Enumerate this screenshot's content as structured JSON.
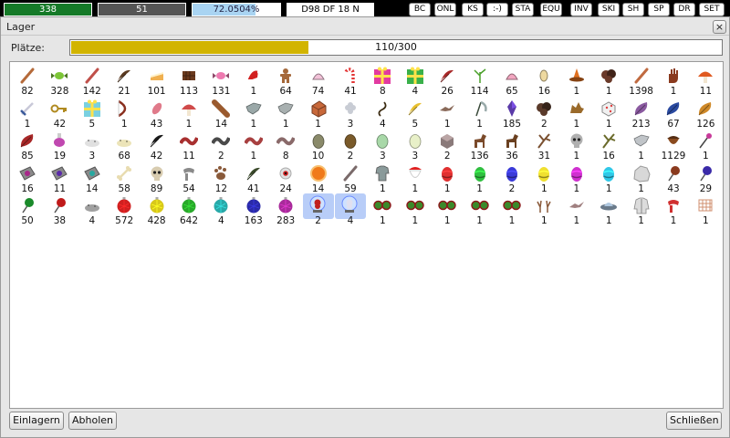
{
  "hud": {
    "hp": {
      "text": "338",
      "fraction": 1.0,
      "color": "#157a28"
    },
    "mp": {
      "text": "51"
    },
    "xp": {
      "text": "72.0504%",
      "fraction": 0.72,
      "color": "#a9d4f2"
    },
    "pos": {
      "text": "D98 DF 18 N"
    },
    "buttons": [
      "BC",
      "ONL",
      "KS",
      ":-)",
      "STA",
      "EQU",
      "INV",
      "SKI",
      "SH",
      "SP",
      "DR",
      "SET"
    ]
  },
  "window": {
    "title": "Lager",
    "close_icon": "×",
    "slots_label": "Plätze:",
    "slots_text": "110/300",
    "slots_fraction": 0.3667,
    "store_button": "Einlagern",
    "take_button": "Abholen",
    "close_button": "Schließen"
  },
  "items": [
    {
      "count": "82",
      "icon": "stick",
      "color": "#b56a3a"
    },
    {
      "count": "328",
      "icon": "candy",
      "color": "#7cc636"
    },
    {
      "count": "142",
      "icon": "stick",
      "color": "#c0504a"
    },
    {
      "count": "21",
      "icon": "feather",
      "color": "#5b3a20"
    },
    {
      "count": "101",
      "icon": "cake",
      "color": "#f0b050"
    },
    {
      "count": "113",
      "icon": "chocolate",
      "color": "#6b3a1e"
    },
    {
      "count": "131",
      "icon": "candy",
      "color": "#ee7ab0"
    },
    {
      "count": "1",
      "icon": "santa-hat",
      "color": "#d22020"
    },
    {
      "count": "64",
      "icon": "gingerbread",
      "color": "#a5683a"
    },
    {
      "count": "74",
      "icon": "shell",
      "color": "#f2c2d8"
    },
    {
      "count": "41",
      "icon": "candy-cane",
      "color": "#e33535"
    },
    {
      "count": "8",
      "icon": "gift",
      "color": "#e23aa0"
    },
    {
      "count": "4",
      "icon": "gift",
      "color": "#3ab04a"
    },
    {
      "count": "26",
      "icon": "feather",
      "color": "#a82828"
    },
    {
      "count": "114",
      "icon": "plant",
      "color": "#4aa02a"
    },
    {
      "count": "65",
      "icon": "shell",
      "color": "#f2a6c0"
    },
    {
      "count": "16",
      "icon": "bean",
      "color": "#eed9a0"
    },
    {
      "count": "1",
      "icon": "witch-hat",
      "color": "#e07020"
    },
    {
      "count": "1",
      "icon": "rock",
      "color": "#6a3a2a"
    },
    {
      "count": "1398",
      "icon": "stick",
      "color": "#c06a40"
    },
    {
      "count": "1",
      "icon": "glove",
      "color": "#8a3a1e"
    },
    {
      "count": "11",
      "icon": "mushroom",
      "color": "#e05a20"
    },
    {
      "count": "1",
      "icon": "sword",
      "color": "#3a5a9a"
    },
    {
      "count": "42",
      "icon": "key",
      "color": "#b08a20"
    },
    {
      "count": "5",
      "icon": "gift",
      "color": "#7ad0e0"
    },
    {
      "count": "1",
      "icon": "bow",
      "color": "#8a3020"
    },
    {
      "count": "43",
      "icon": "petal",
      "color": "#e07a8a"
    },
    {
      "count": "1",
      "icon": "mushroom",
      "color": "#d04a4a"
    },
    {
      "count": "14",
      "icon": "log",
      "color": "#9a5a2e"
    },
    {
      "count": "1",
      "icon": "cloth",
      "color": "#9aa8a8"
    },
    {
      "count": "1",
      "icon": "cloth",
      "color": "#a8b0b0"
    },
    {
      "count": "1",
      "icon": "box",
      "color": "#c8683a"
    },
    {
      "count": "3",
      "icon": "fluff",
      "color": "#c8ccd4"
    },
    {
      "count": "4",
      "icon": "rope",
      "color": "#3a2a10"
    },
    {
      "count": "5",
      "icon": "feather",
      "color": "#e8c030"
    },
    {
      "count": "1",
      "icon": "bird",
      "color": "#8a6a5a"
    },
    {
      "count": "1",
      "icon": "scythe",
      "color": "#3a4a3a"
    },
    {
      "count": "185",
      "icon": "crystal",
      "color": "#5a3aa8"
    },
    {
      "count": "2",
      "icon": "rock",
      "color": "#5a3a2a"
    },
    {
      "count": "1",
      "icon": "wolf",
      "color": "#9a6a2a"
    },
    {
      "count": "1",
      "icon": "dice",
      "color": "#e04040"
    },
    {
      "count": "213",
      "icon": "leaf",
      "color": "#8a5aa0"
    },
    {
      "count": "67",
      "icon": "leaf",
      "color": "#2a4aa0"
    },
    {
      "count": "126",
      "icon": "leaf",
      "color": "#d08a2a"
    },
    {
      "count": "85",
      "icon": "leaf",
      "color": "#a82828"
    },
    {
      "count": "19",
      "icon": "potion",
      "color": "#c048b0"
    },
    {
      "count": "3",
      "icon": "powder",
      "color": "#e0e0e0"
    },
    {
      "count": "68",
      "icon": "powder",
      "color": "#ece4b8"
    },
    {
      "count": "42",
      "icon": "feather",
      "color": "#1a1a1a"
    },
    {
      "count": "11",
      "icon": "snake",
      "color": "#a83030"
    },
    {
      "count": "2",
      "icon": "snake",
      "color": "#4a4a4a"
    },
    {
      "count": "1",
      "icon": "snake",
      "color": "#a84040"
    },
    {
      "count": "8",
      "icon": "snake",
      "color": "#8a6a6a"
    },
    {
      "count": "10",
      "icon": "egg",
      "color": "#8a8a6a"
    },
    {
      "count": "2",
      "icon": "egg",
      "color": "#7a5a2a"
    },
    {
      "count": "3",
      "icon": "egg",
      "color": "#a8d8a8"
    },
    {
      "count": "3",
      "icon": "egg",
      "color": "#e8f0c8"
    },
    {
      "count": "2",
      "icon": "cube",
      "color": "#8a7a7a"
    },
    {
      "count": "136",
      "icon": "horse",
      "color": "#7a4a2a"
    },
    {
      "count": "36",
      "icon": "horse",
      "color": "#6a4020"
    },
    {
      "count": "31",
      "icon": "branch",
      "color": "#7a5030"
    },
    {
      "count": "1",
      "icon": "skull",
      "color": "#b0b0b0"
    },
    {
      "count": "16",
      "icon": "branch",
      "color": "#6a6a2a"
    },
    {
      "count": "1",
      "icon": "cloth",
      "color": "#c0c4c8"
    },
    {
      "count": "1129",
      "icon": "nut",
      "color": "#8a4a1e"
    },
    {
      "count": "1",
      "icon": "wand",
      "color": "#c83a9a"
    },
    {
      "count": "16",
      "icon": "tile",
      "color": "#a8288a"
    },
    {
      "count": "11",
      "icon": "tile",
      "color": "#5a2aa8"
    },
    {
      "count": "14",
      "icon": "tile",
      "color": "#28a8a0"
    },
    {
      "count": "58",
      "icon": "bone",
      "color": "#e8dcb0"
    },
    {
      "count": "89",
      "icon": "skull",
      "color": "#d8ccb0"
    },
    {
      "count": "54",
      "icon": "scarf",
      "color": "#8a8a8a"
    },
    {
      "count": "12",
      "icon": "paw",
      "color": "#8a5a3a"
    },
    {
      "count": "41",
      "icon": "feather",
      "color": "#3a4a2a"
    },
    {
      "count": "24",
      "icon": "eye",
      "color": "#e0e0e0"
    },
    {
      "count": "14",
      "icon": "orb",
      "color": "#f07a1a"
    },
    {
      "count": "59",
      "icon": "stick",
      "color": "#7a6a6a"
    },
    {
      "count": "1",
      "icon": "armor",
      "color": "#8a9a9a"
    },
    {
      "count": "1",
      "icon": "beard",
      "color": "#e02020"
    },
    {
      "count": "1",
      "icon": "easter-egg",
      "color": "#e03030"
    },
    {
      "count": "1",
      "icon": "easter-egg",
      "color": "#30c040"
    },
    {
      "count": "2",
      "icon": "easter-egg",
      "color": "#3a3ad8"
    },
    {
      "count": "1",
      "icon": "easter-egg",
      "color": "#f0e030"
    },
    {
      "count": "1",
      "icon": "easter-egg",
      "color": "#d030d0"
    },
    {
      "count": "1",
      "icon": "easter-egg",
      "color": "#30c8e8"
    },
    {
      "count": "1",
      "icon": "stone",
      "color": "#d8d8d8"
    },
    {
      "count": "43",
      "icon": "lollipop",
      "color": "#8a3a1e"
    },
    {
      "count": "29",
      "icon": "lollipop",
      "color": "#3a2aa8"
    },
    {
      "count": "50",
      "icon": "lollipop",
      "color": "#1a8a2a"
    },
    {
      "count": "38",
      "icon": "lollipop",
      "color": "#c01a1a"
    },
    {
      "count": "4",
      "icon": "powder",
      "color": "#a0a0a0"
    },
    {
      "count": "572",
      "icon": "ornament",
      "color": "#d02020"
    },
    {
      "count": "428",
      "icon": "ornament",
      "color": "#d8c81a"
    },
    {
      "count": "642",
      "icon": "ornament",
      "color": "#28a82a"
    },
    {
      "count": "4",
      "icon": "ornament",
      "color": "#28a8a8"
    },
    {
      "count": "163",
      "icon": "ornament",
      "color": "#2a2aa8"
    },
    {
      "count": "283",
      "icon": "ornament",
      "color": "#a82a9a"
    },
    {
      "count": "2",
      "icon": "snow-globe",
      "color": "#c02020",
      "selected": true
    },
    {
      "count": "4",
      "icon": "snow-globe",
      "color": "#e0e0f0",
      "selected": true
    },
    {
      "count": "1",
      "icon": "goggles",
      "color": "#3a8a2a"
    },
    {
      "count": "1",
      "icon": "goggles",
      "color": "#3a8a2a"
    },
    {
      "count": "1",
      "icon": "goggles",
      "color": "#3a8a2a"
    },
    {
      "count": "1",
      "icon": "goggles",
      "color": "#3a8a2a"
    },
    {
      "count": "1",
      "icon": "goggles",
      "color": "#3a8a2a"
    },
    {
      "count": "1",
      "icon": "antlers",
      "color": "#8a5a3a"
    },
    {
      "count": "1",
      "icon": "bird",
      "color": "#a08080"
    },
    {
      "count": "1",
      "icon": "ufo",
      "color": "#6a7a8a"
    },
    {
      "count": "1",
      "icon": "coat",
      "color": "#dcdcdc"
    },
    {
      "count": "1",
      "icon": "scarf",
      "color": "#d03030"
    },
    {
      "count": "1",
      "icon": "net",
      "color": "#d09070"
    }
  ]
}
